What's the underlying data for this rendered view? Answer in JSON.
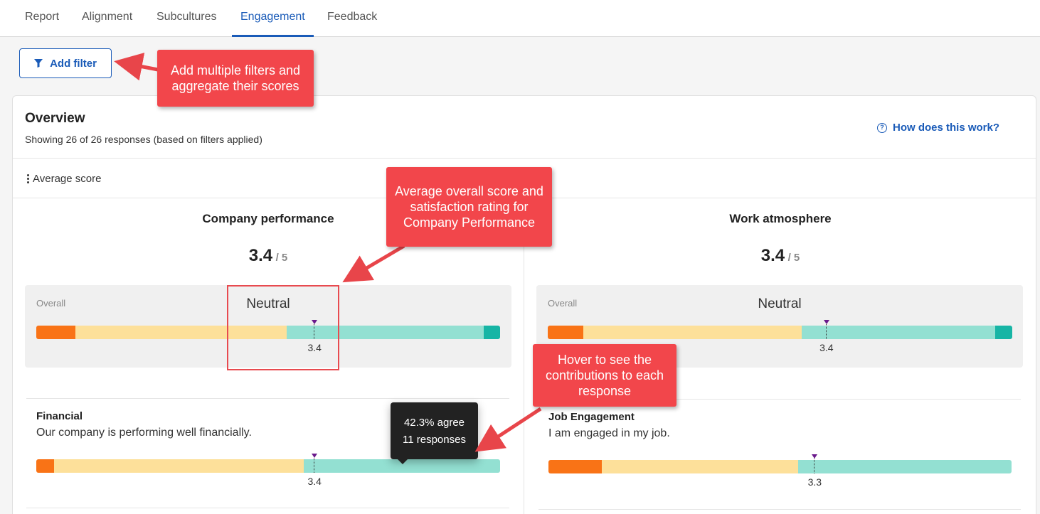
{
  "tabs": [
    {
      "label": "Report"
    },
    {
      "label": "Alignment"
    },
    {
      "label": "Subcultures"
    },
    {
      "label": "Engagement"
    },
    {
      "label": "Feedback"
    }
  ],
  "active_tab": "Engagement",
  "filter": {
    "add_label": "Add filter"
  },
  "overview": {
    "title": "Overview",
    "subtitle": "Showing 26 of 26 responses (based on filters applied)",
    "help_link": "How does this work?",
    "sort_label": "Average score"
  },
  "columns": [
    {
      "title": "Company performance",
      "score": "3.4",
      "score_max": "/ 5",
      "overall_label": "Overall",
      "sentiment": "Neutral",
      "overall_value": "3.4",
      "overall_marker_fraction": 0.6,
      "overall_distribution": [
        0.085,
        0.455,
        0.425,
        0.035
      ],
      "item": {
        "title": "Financial",
        "question": "Our company is performing well financially.",
        "value": "3.4",
        "marker_fraction": 0.6,
        "distribution": [
          0.038,
          0.539,
          0.423,
          0.0
        ]
      }
    },
    {
      "title": "Work atmosphere",
      "score": "3.4",
      "score_max": "/ 5",
      "overall_label": "Overall",
      "sentiment": "Neutral",
      "overall_value": "3.4",
      "overall_marker_fraction": 0.6,
      "overall_distribution": [
        0.077,
        0.47,
        0.416,
        0.037
      ],
      "item": {
        "title": "Job Engagement",
        "question": "I am engaged in my job.",
        "value": "3.3",
        "marker_fraction": 0.575,
        "distribution": [
          0.115,
          0.424,
          0.461,
          0.0
        ]
      }
    }
  ],
  "tooltip": {
    "line1": "42.3% agree",
    "line2": "11 responses"
  },
  "callouts": {
    "filters": "Add multiple filters and aggregate their scores",
    "average": "Average overall score and satisfaction rating for Company Performance",
    "hover": "Hover to see the contributions to each response"
  },
  "colors": {
    "strongly_disagree": "#f97316",
    "disagree": "#fde09a",
    "agree": "#93e0d2",
    "strongly_agree": "#17b5a5",
    "accent": "#1a5bb8",
    "callout": "#f2464b",
    "marker": "#6b1a8c"
  }
}
